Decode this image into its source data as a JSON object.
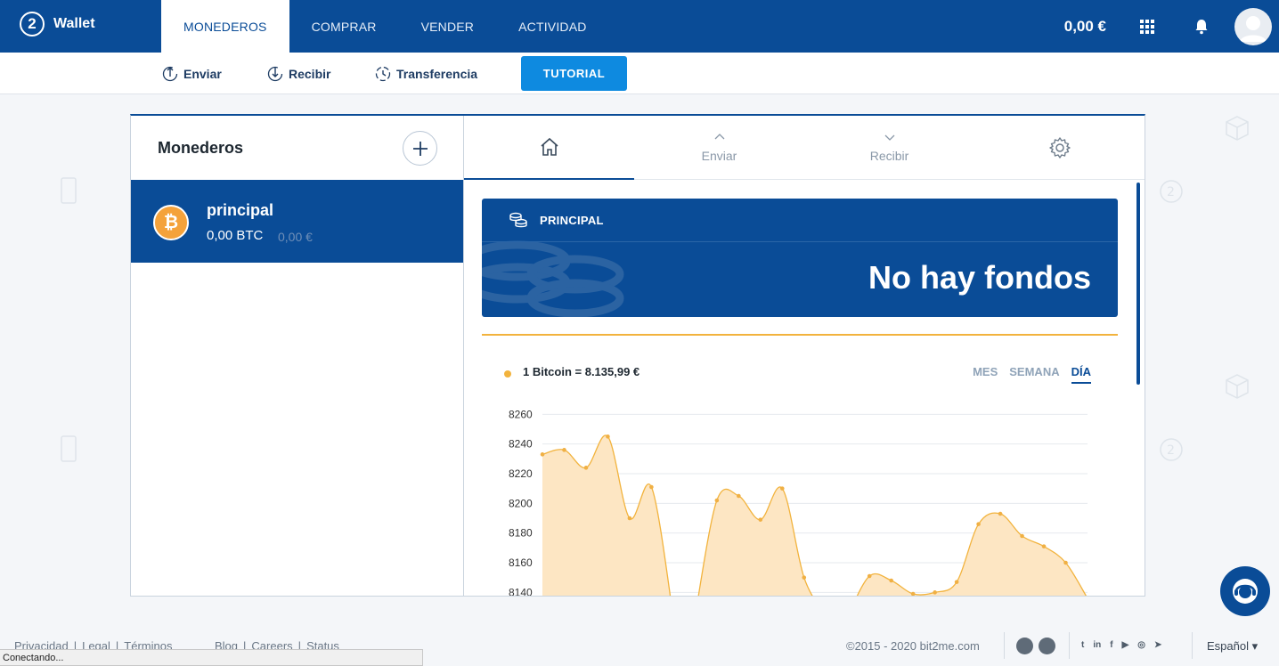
{
  "app": {
    "logo_mark": "2",
    "logo_text": "Wallet"
  },
  "nav": {
    "tabs": [
      {
        "label": "MONEDEROS",
        "active": true
      },
      {
        "label": "COMPRAR",
        "active": false
      },
      {
        "label": "VENDER",
        "active": false
      },
      {
        "label": "ACTIVIDAD",
        "active": false
      }
    ],
    "balance": "0,00 €",
    "icons": [
      "apps-grid-icon",
      "bell-icon",
      "avatar-icon"
    ]
  },
  "subbar": {
    "send": "Enviar",
    "receive": "Recibir",
    "transfer": "Transferencia",
    "tutorial": "TUTORIAL"
  },
  "wallets": {
    "title": "Monederos",
    "items": [
      {
        "name": "principal",
        "amount": "0,00 BTC",
        "fiat": "0,00 €",
        "coin_symbol": "₿"
      }
    ]
  },
  "detail": {
    "tabs": [
      {
        "label": "",
        "icon": "home-icon",
        "active": true
      },
      {
        "label": "Enviar",
        "icon": "chevron-up-icon"
      },
      {
        "label": "Recibir",
        "icon": "chevron-down-icon"
      },
      {
        "label": "",
        "icon": "gear-icon"
      }
    ],
    "banner_label": "PRINCIPAL",
    "banner_text": "No hay fondos",
    "price_text": "1 Bitcoin = 8.135,99 €",
    "ranges": [
      "MES",
      "SEMANA",
      "DÍA"
    ],
    "active_range": "DÍA"
  },
  "chart_data": {
    "type": "area",
    "title": "",
    "xlabel": "",
    "ylabel": "",
    "yticks": [
      8260,
      8240,
      8220,
      8200,
      8180,
      8160,
      8140
    ],
    "ylim": [
      8127,
      8262
    ],
    "series": [
      {
        "color": "#f2b33d",
        "segments": [
          [
            [
              0,
              8233
            ],
            [
              1,
              8236
            ],
            [
              2,
              8224
            ],
            [
              3,
              8245
            ],
            [
              4,
              8190
            ],
            [
              5,
              8211
            ],
            [
              6,
              8124
            ]
          ],
          [
            [
              7,
              8124
            ],
            [
              8,
              8202
            ],
            [
              9,
              8205
            ],
            [
              10,
              8189
            ],
            [
              11,
              8210
            ],
            [
              12,
              8150
            ],
            [
              13,
              8124
            ]
          ],
          [
            [
              14,
              8124
            ],
            [
              15,
              8151
            ],
            [
              16,
              8148
            ],
            [
              17,
              8139
            ],
            [
              18,
              8140
            ],
            [
              19,
              8147
            ],
            [
              20,
              8186
            ],
            [
              21,
              8193
            ],
            [
              22,
              8178
            ],
            [
              23,
              8171
            ],
            [
              24,
              8160
            ],
            [
              25,
              8136
            ]
          ]
        ]
      }
    ],
    "grid": true
  },
  "footer": {
    "links_left": [
      "Privacidad",
      "|",
      "Legal",
      "|",
      "Términos"
    ],
    "links_mid": [
      "Blog",
      "|",
      "Careers",
      "|",
      "Status"
    ],
    "copyright": "©2015 - 2020  bit2me.com",
    "social": [
      "twitter-icon",
      "linkedin-icon",
      "facebook-icon",
      "youtube-icon",
      "instagram-icon",
      "telegram-icon"
    ],
    "language": "Español ▾",
    "status": "Conectando..."
  },
  "colors": {
    "brand": "#0a4c97",
    "accent": "#0e8ae0",
    "btc": "#f4a23b",
    "chart": "#f2b33d"
  }
}
